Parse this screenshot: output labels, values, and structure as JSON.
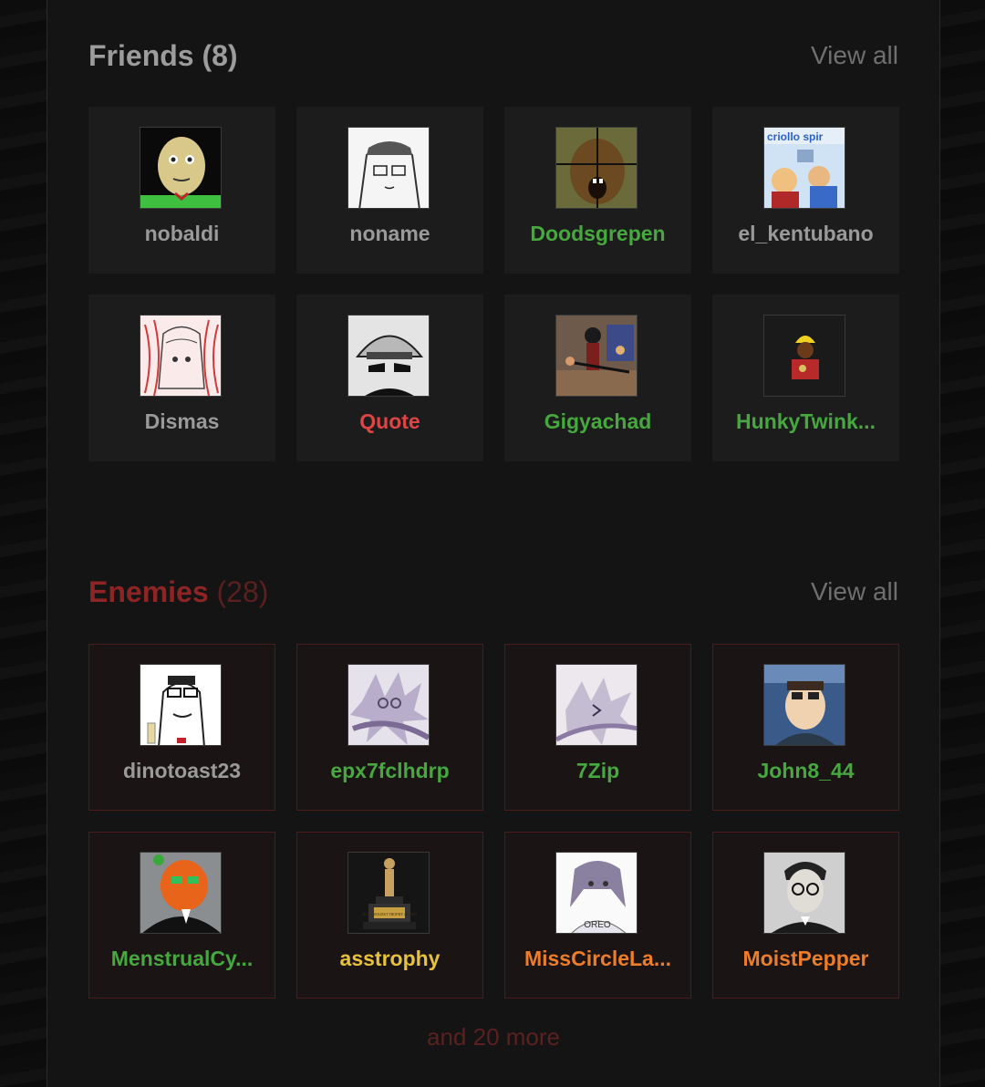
{
  "friends": {
    "title": "Friends",
    "count": "(8)",
    "view_all": "View all",
    "items": [
      {
        "name": "nobaldi",
        "color": "#9a9a9a"
      },
      {
        "name": "noname",
        "color": "#9a9a9a"
      },
      {
        "name": "Doodsgrepen",
        "color": "#47a83f"
      },
      {
        "name": "el_kentubano",
        "color": "#9a9a9a"
      },
      {
        "name": "Dismas",
        "color": "#9a9a9a"
      },
      {
        "name": "Quote",
        "color": "#e04545"
      },
      {
        "name": "Gigyachad",
        "color": "#47a83f"
      },
      {
        "name": "HunkyTwink...",
        "color": "#47a83f"
      }
    ]
  },
  "enemies": {
    "title": "Enemies",
    "count": "(28)",
    "view_all": "View all",
    "items": [
      {
        "name": "dinotoast23",
        "color": "#9a9a9a"
      },
      {
        "name": "epx7fclhdrp",
        "color": "#47a83f"
      },
      {
        "name": "7Zip",
        "color": "#47a83f"
      },
      {
        "name": "John8_44",
        "color": "#47a83f"
      },
      {
        "name": "MenstrualCy...",
        "color": "#47a83f"
      },
      {
        "name": "asstrophy",
        "color": "#e8c23a"
      },
      {
        "name": "MissCircleLa...",
        "color": "#ee7d2a"
      },
      {
        "name": "MoistPepper",
        "color": "#ee7d2a"
      }
    ],
    "more": "and 20 more"
  },
  "avatar_texts": {
    "criollo": "criollo spir",
    "trophy": "MOST HOLIEST TROPHY AWARD",
    "oreo": "OREO"
  }
}
